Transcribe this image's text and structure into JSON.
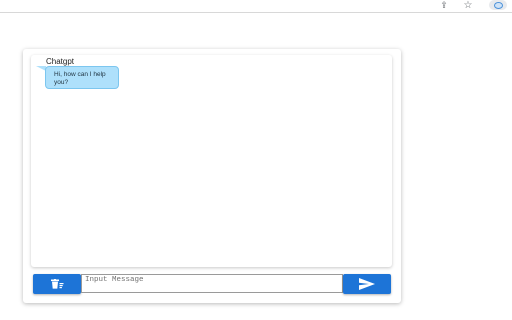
{
  "browser": {
    "toolbar_icons": [
      "share-icon",
      "star-icon",
      "extension-icon"
    ],
    "share_glyph": "⇪",
    "star_glyph": "☆"
  },
  "chat": {
    "sender_name": "Chatgpt",
    "greeting_message": "Hi, how can I help you?",
    "bubble_color": "#aee0fb"
  },
  "composer": {
    "placeholder": "Input Message",
    "clear_icon": "trash-clear-icon",
    "send_icon": "send-icon",
    "button_color": "#1d74d7"
  }
}
